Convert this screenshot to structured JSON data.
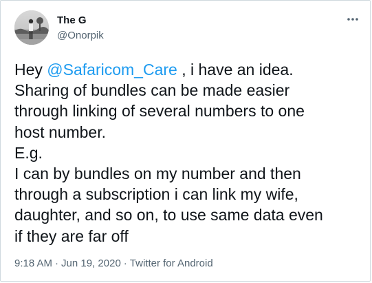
{
  "author": {
    "display_name": "The G",
    "handle": "@Onorpik",
    "avatar": "avatar-photo"
  },
  "more_icon": "more-horizontal-icon",
  "tweet": {
    "prefix": "Hey ",
    "mention": "@Safaricom_Care",
    "body": " , i have an idea.\nSharing of bundles can be made easier\nthrough linking of several numbers to one\nhost number.\nE.g.\nI can by bundles on my number and then\nthrough a subscription i can link my wife,\ndaughter, and so on, to use same data even\nif they are far off"
  },
  "meta": {
    "time": "9:18 AM",
    "separator": "·",
    "date": "Jun 19, 2020",
    "source": "Twitter for Android"
  },
  "colors": {
    "link": "#1d9bf0",
    "text": "#0f1419",
    "secondary": "#536471",
    "border": "#cfd9de"
  }
}
